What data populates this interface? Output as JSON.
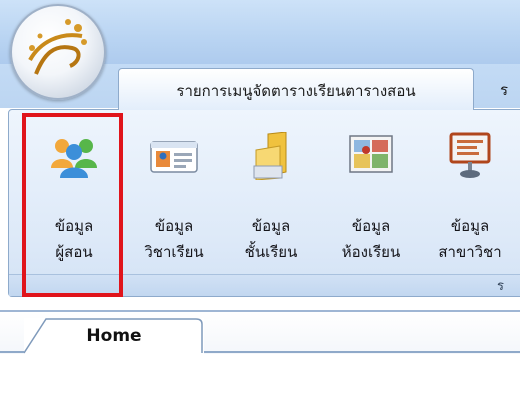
{
  "ribbon": {
    "tabs": [
      {
        "label": "รายการเมนูจัดตารางเรียนตารางสอน"
      },
      {
        "label": "ร"
      }
    ],
    "buttons": [
      {
        "line1": "ข้อมูล",
        "line2": "ผู้สอน",
        "icon": "users-icon"
      },
      {
        "line1": "ข้อมูล",
        "line2": "วิชาเรียน",
        "icon": "id-card-icon"
      },
      {
        "line1": "ข้อมูล",
        "line2": "ชั้นเรียน",
        "icon": "folder-icon"
      },
      {
        "line1": "ข้อมูล",
        "line2": "ห้องเรียน",
        "icon": "classroom-icon"
      },
      {
        "line1": "ข้อมูล",
        "line2": "สาขาวิชา",
        "icon": "presentation-board-icon"
      }
    ],
    "group_label": "ร"
  },
  "document_tabs": [
    {
      "label": "Home"
    }
  ],
  "colors": {
    "highlight": "#e0141b",
    "ribbon_border": "#8eaacb"
  }
}
